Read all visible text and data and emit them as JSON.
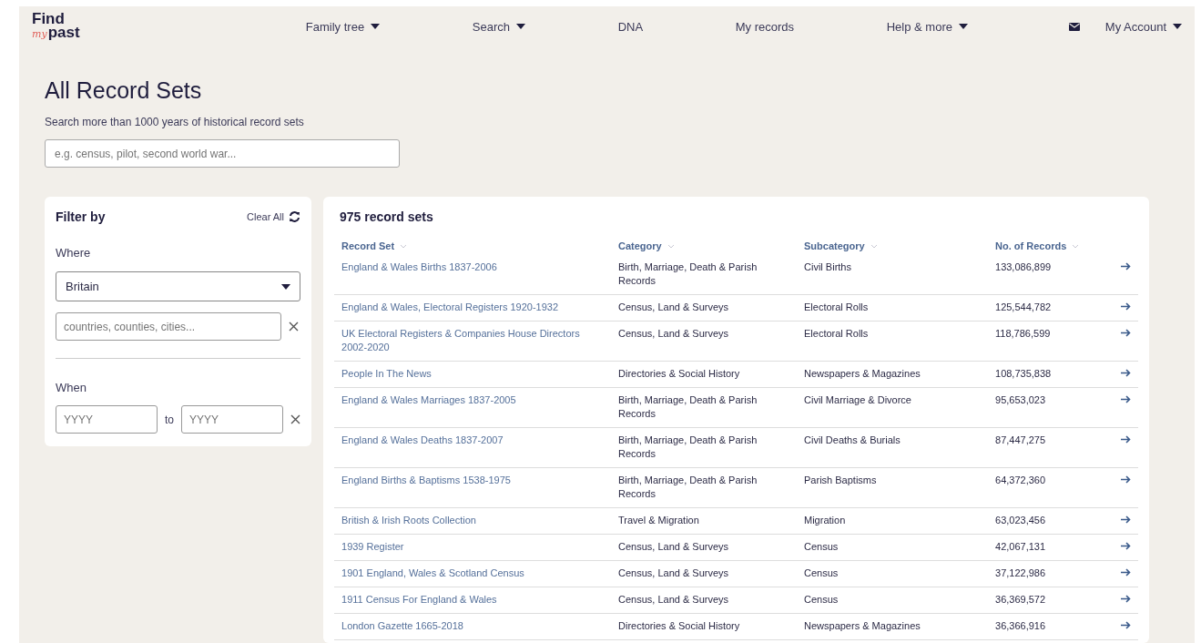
{
  "logo": {
    "line1": "Find",
    "script": "my",
    "line2": "past"
  },
  "nav": [
    {
      "label": "Family tree",
      "dropdown": true
    },
    {
      "label": "Search",
      "dropdown": true
    },
    {
      "label": "DNA",
      "dropdown": false
    },
    {
      "label": "My records",
      "dropdown": false
    },
    {
      "label": "Help & more",
      "dropdown": true
    }
  ],
  "account": {
    "label": "My Account",
    "dropdown": true
  },
  "page": {
    "title": "All Record Sets",
    "subtitle": "Search more than 1000 years of historical record sets",
    "search": {
      "placeholder": "e.g. census, pilot, second world war..."
    }
  },
  "filter": {
    "title": "Filter by",
    "clear": "Clear All",
    "where": {
      "label": "Where",
      "select": "Britain",
      "place": {
        "placeholder": "countries, counties, cities..."
      }
    },
    "when": {
      "label": "When",
      "from": {
        "placeholder": "YYYY"
      },
      "separator": "to",
      "to": {
        "placeholder": "YYYY"
      }
    }
  },
  "results": {
    "count": "975 record sets",
    "columns": [
      "Record Set",
      "Category",
      "Subcategory",
      "No. of Records"
    ],
    "rows": [
      [
        "England & Wales Births 1837-2006",
        "Birth, Marriage, Death & Parish Records",
        "Civil Births",
        "133,086,899"
      ],
      [
        "England & Wales, Electoral Registers 1920-1932",
        "Census, Land & Surveys",
        "Electoral Rolls",
        "125,544,782"
      ],
      [
        "UK Electoral Registers & Companies House Directors 2002-2020",
        "Census, Land & Surveys",
        "Electoral Rolls",
        "118,786,599"
      ],
      [
        "People In The News",
        "Directories & Social History",
        "Newspapers & Magazines",
        "108,735,838"
      ],
      [
        "England & Wales Marriages 1837-2005",
        "Birth, Marriage, Death & Parish Records",
        "Civil Marriage & Divorce",
        "95,653,023"
      ],
      [
        "England & Wales Deaths 1837-2007",
        "Birth, Marriage, Death & Parish Records",
        "Civil Deaths & Burials",
        "87,447,275"
      ],
      [
        "England Births & Baptisms 1538-1975",
        "Birth, Marriage, Death & Parish Records",
        "Parish Baptisms",
        "64,372,360"
      ],
      [
        "British & Irish Roots Collection",
        "Travel & Migration",
        "Migration",
        "63,023,456"
      ],
      [
        "1939 Register",
        "Census, Land & Surveys",
        "Census",
        "42,067,131"
      ],
      [
        "1901 England, Wales & Scotland Census",
        "Census, Land & Surveys",
        "Census",
        "37,122,986"
      ],
      [
        "1911 Census For England & Wales",
        "Census, Land & Surveys",
        "Census",
        "36,369,572"
      ],
      [
        "London Gazette 1665-2018",
        "Directories & Social History",
        "Newspapers & Magazines",
        "36,366,916"
      ]
    ]
  }
}
